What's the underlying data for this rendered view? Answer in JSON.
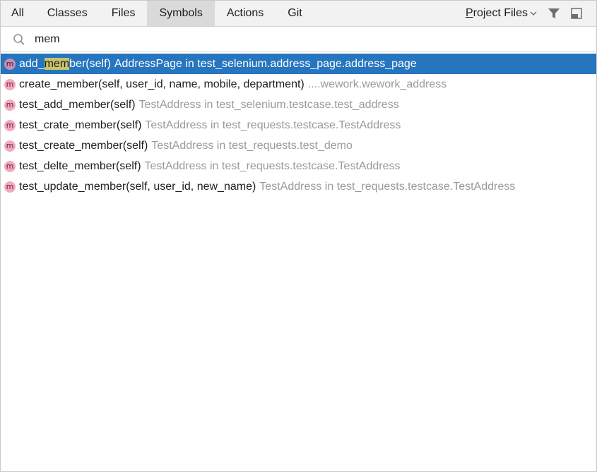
{
  "tabs": [
    {
      "label": "All",
      "active": false
    },
    {
      "label": "Classes",
      "active": false
    },
    {
      "label": "Files",
      "active": false
    },
    {
      "label": "Symbols",
      "active": true
    },
    {
      "label": "Actions",
      "active": false
    },
    {
      "label": "Git",
      "active": false
    }
  ],
  "scope": {
    "label": "Project Files",
    "mnemonic": "P"
  },
  "tools": {
    "filter_icon": "funnel-icon",
    "pin_icon": "open-in-window-icon"
  },
  "search": {
    "value": "mem",
    "icon": "search-icon"
  },
  "badge_letter": "m",
  "results": [
    {
      "pre": "add_",
      "match": "mem",
      "post": "ber(self)",
      "location": "AddressPage in test_selenium.address_page.address_page",
      "selected": true
    },
    {
      "pre": "create_member(self, user_id, name, mobile, department)",
      "match": "",
      "post": "",
      "location": "....wework.wework_address",
      "selected": false
    },
    {
      "pre": "test_add_member(self)",
      "match": "",
      "post": "",
      "location": "TestAddress in test_selenium.testcase.test_address",
      "selected": false
    },
    {
      "pre": "test_crate_member(self)",
      "match": "",
      "post": "",
      "location": "TestAddress in test_requests.testcase.TestAddress",
      "selected": false
    },
    {
      "pre": "test_create_member(self)",
      "match": "",
      "post": "",
      "location": "TestAddress in test_requests.test_demo",
      "selected": false
    },
    {
      "pre": "test_delte_member(self)",
      "match": "",
      "post": "",
      "location": "TestAddress in test_requests.testcase.TestAddress",
      "selected": false
    },
    {
      "pre": "test_update_member(self, user_id, new_name)",
      "match": "",
      "post": "",
      "location": "TestAddress in test_requests.testcase.TestAddress",
      "selected": false
    }
  ],
  "colors": {
    "selection": "#2675bf",
    "match_highlight": "#c9c36b",
    "badge": "#f4a9bd",
    "location_text": "#9a9a9a"
  }
}
